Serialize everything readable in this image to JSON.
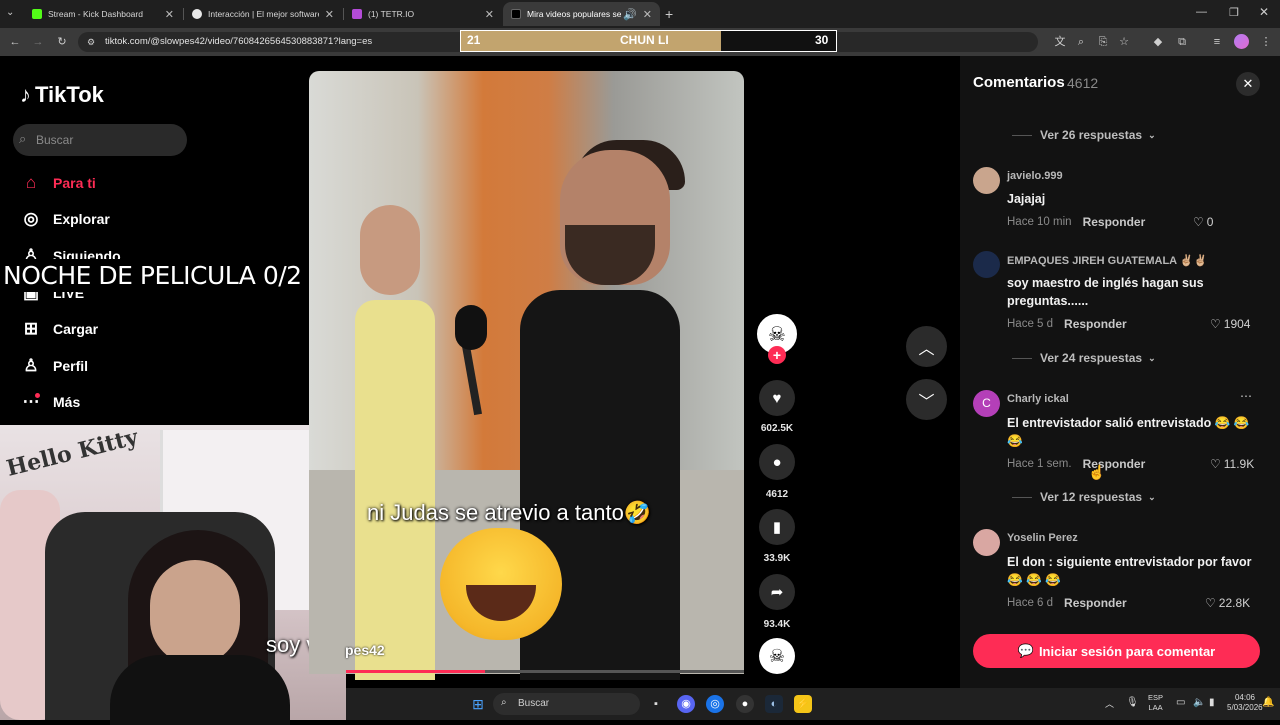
{
  "browser": {
    "tabs": [
      {
        "title": "Stream - Kick Dashboard",
        "color": "#53fc18"
      },
      {
        "title": "Interacción | El mejor software",
        "color": "#ffffff"
      },
      {
        "title": "(1) TETR.IO",
        "color": "#b44bd8"
      },
      {
        "title": "Mira videos populares selec",
        "color": "#000000"
      }
    ],
    "url": "tiktok.com/@slowpes42/video/7608426564530883871?lang=es"
  },
  "score_overlay": {
    "left": "21",
    "center": "CHUN LI",
    "right": "30"
  },
  "tiktok": {
    "logo": "TikTok",
    "search_placeholder": "Buscar",
    "nav": [
      {
        "label": "Para ti",
        "icon": "home-icon"
      },
      {
        "label": "Explorar",
        "icon": "compass-icon"
      },
      {
        "label": "Siguiendo",
        "icon": "person-icon"
      },
      {
        "label": "LIVE",
        "icon": "live-icon"
      },
      {
        "label": "Cargar",
        "icon": "upload-icon"
      },
      {
        "label": "Perfil",
        "icon": "profile-icon"
      },
      {
        "label": "Más",
        "icon": "more-icon"
      }
    ]
  },
  "stream_overlay": {
    "title": "NOCHE DE PELICULA 0/2",
    "webcam_caption": "soy virgen",
    "webcam_decor": "Hello Kitty"
  },
  "video": {
    "caption": "ni Judas se atrevio a tanto🤣",
    "username": "pes42",
    "progress": 0.35,
    "actions": {
      "likes": "602.5K",
      "comments": "4612",
      "saves": "33.9K",
      "shares": "93.4K"
    }
  },
  "comments": {
    "title": "Comentarios",
    "count": "4612",
    "threads": [
      {
        "more_replies": "Ver 26 respuestas"
      },
      {
        "user": "javielo.999",
        "text": "Jajajaj",
        "time": "Hace 10 min",
        "reply": "Responder",
        "likes": "0"
      },
      {
        "user": "EMPAQUES JIREH GUATEMALA ✌🏼✌🏼",
        "text": "soy maestro de inglés hagan sus preguntas......",
        "time": "Hace 5 d",
        "reply": "Responder",
        "likes": "1904"
      },
      {
        "more_replies": "Ver 24 respuestas"
      },
      {
        "user": "Charly ickal",
        "avatar_letter": "C",
        "text": "El entrevistador salió entrevistado 😂 😂 😂",
        "time": "Hace 1 sem.",
        "reply": "Responder",
        "likes": "11.9K"
      },
      {
        "more_replies": "Ver 12 respuestas"
      },
      {
        "user": "Yoselin Perez",
        "text": "El don : siguiente entrevistador por favor 😂 😂 😂",
        "time": "Hace 6 d",
        "reply": "Responder",
        "likes": "22.8K"
      }
    ],
    "login_button": "Iniciar sesión para comentar"
  },
  "taskbar": {
    "search_placeholder": "Buscar",
    "lang_top": "ESP",
    "lang_bottom": "LAA",
    "time": "04:06",
    "date": "5/03/2026"
  }
}
